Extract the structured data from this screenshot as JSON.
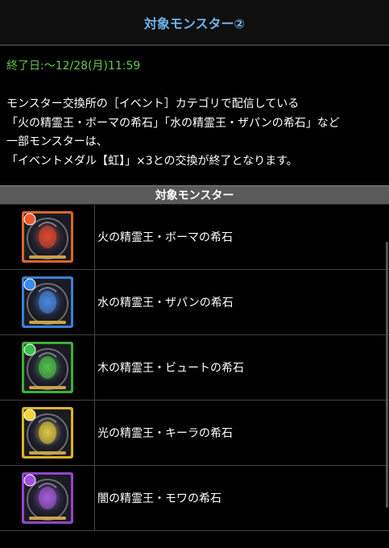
{
  "header": {
    "title": "対象モンスター②"
  },
  "deadline": "終了日:～12/28(月)11:59",
  "description": [
    "モンスター交換所の［イベント］カテゴリで配信している",
    "「火の精霊王・ボーマの希石」「水の精霊王・ザパンの希石」など",
    "一部モンスターは、",
    "「イベントメダル【虹】」×3との交換が終了となります。"
  ],
  "table": {
    "header": "対象モンスター",
    "rows": [
      {
        "name": "火の精霊王・ボーマの希石",
        "frame": "#d9652b",
        "glow": "#e84a2e",
        "orb": "#f05a2a",
        "orb_icon": "fire-orb-icon"
      },
      {
        "name": "水の精霊王・ザパンの希石",
        "frame": "#3d7fd6",
        "glow": "#4a8de8",
        "orb": "#3a8bf0",
        "orb_icon": "water-orb-icon"
      },
      {
        "name": "木の精霊王・ビュートの希石",
        "frame": "#3fae3a",
        "glow": "#55c84c",
        "orb": "#3cc24a",
        "orb_icon": "wood-orb-icon"
      },
      {
        "name": "光の精霊王・キーラの希石",
        "frame": "#d6b52a",
        "glow": "#e8cf45",
        "orb": "#f0d23a",
        "orb_icon": "light-orb-icon"
      },
      {
        "name": "闇の精霊王・モワの希石",
        "frame": "#9246c9",
        "glow": "#a95ee0",
        "orb": "#a64de0",
        "orb_icon": "dark-orb-icon"
      }
    ]
  }
}
